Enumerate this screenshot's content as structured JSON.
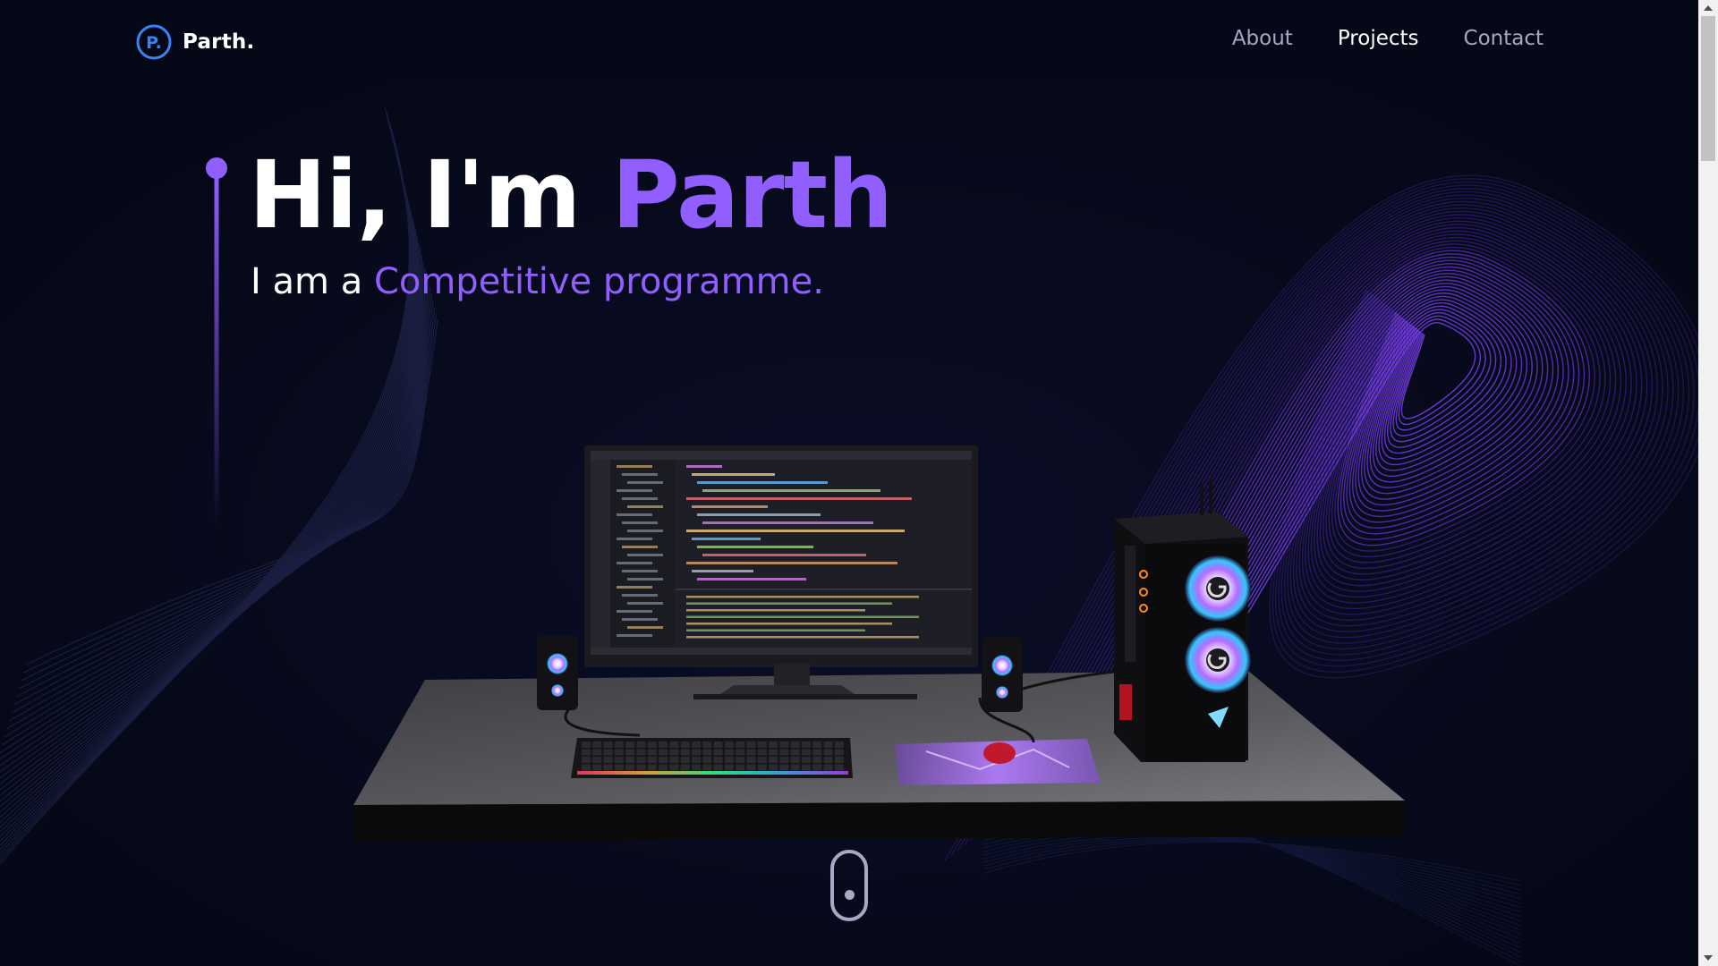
{
  "brand": {
    "name": "Parth.",
    "logo_letter": "P."
  },
  "nav": {
    "links": [
      "About",
      "Projects",
      "Contact"
    ],
    "active": "Projects"
  },
  "hero": {
    "greeting": "Hi, I'm ",
    "name": "Parth",
    "subtitle_prefix": "I am a ",
    "subtitle_role": "Competitive programme",
    "subtitle_cursor": "."
  },
  "colors": {
    "background": "#050816",
    "accent": "#915eff",
    "muted": "#aaa6c3",
    "text": "#ffffff"
  },
  "icons": {
    "logo": "logo-icon",
    "scroll": "mouse-scroll-icon"
  }
}
